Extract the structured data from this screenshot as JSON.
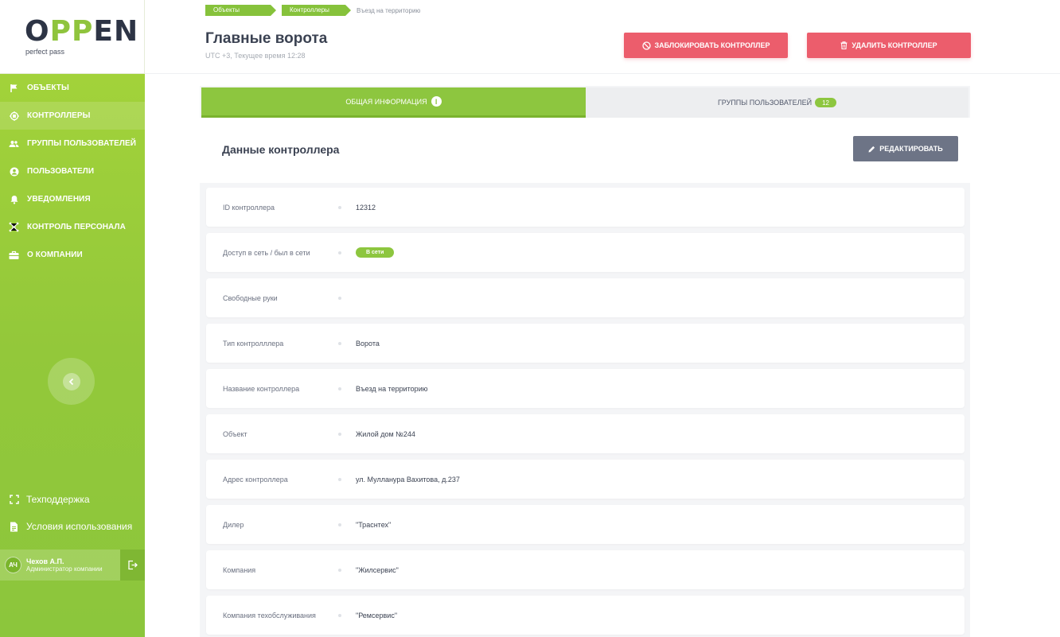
{
  "brand": {
    "logo_prefix": "O",
    "logo_accent": "PP",
    "logo_suffix": "EN",
    "tagline": "perfect pass",
    "accent_color": "#8dc63f"
  },
  "sidebar": {
    "items": [
      {
        "label": "ОБЪЕКТЫ",
        "icon": "flag-icon"
      },
      {
        "label": "КОНТРОЛЛЕРЫ",
        "icon": "chip-icon"
      },
      {
        "label": "ГРУППЫ ПОЛЬЗОВАТЕЛЕЙ",
        "icon": "users-icon"
      },
      {
        "label": "ПОЛЬЗОВАТЕЛИ",
        "icon": "user-icon"
      },
      {
        "label": "УВЕДОМЛЕНИЯ",
        "icon": "bell-icon"
      },
      {
        "label": "КОНТРОЛЬ ПЕРСОНАЛА",
        "icon": "network-icon"
      },
      {
        "label": "О КОМПАНИИ",
        "icon": "briefcase-icon"
      }
    ],
    "support": "Техподдержка",
    "terms": "Условия использования",
    "user": {
      "initials": "АЧ",
      "name": "Чехов А.П.",
      "role": "Администратор компании"
    }
  },
  "breadcrumbs": {
    "objects": "Объекты",
    "controllers": "Контроллеры",
    "current": "Въезд на территорию"
  },
  "header": {
    "title": "Главные ворота",
    "subtitle": "UTC +3, Текущее время 12:28",
    "block_label": "ЗАБЛОКИРОВАТЬ КОНТРОЛЛЕР",
    "delete_label": "УДАЛИТЬ КОНТРОЛЛЕР",
    "danger_color": "#ec5d6c"
  },
  "tabs": {
    "general": {
      "label": "ОБЩАЯ ИНФОРМАЦИЯ",
      "badge": "i"
    },
    "groups": {
      "label": "ГРУППЫ ПОЛЬЗОВАТЕЛЕЙ",
      "badge": "12"
    }
  },
  "card": {
    "title": "Данные контроллера",
    "edit_label": "РЕДАКТИРОВАТЬ"
  },
  "details": {
    "id": {
      "label": "ID контроллера",
      "value": "12312"
    },
    "online": {
      "label": "Доступ в сеть / был в сети",
      "value": "В сети"
    },
    "handsfree": {
      "label": "Свободные руки",
      "value": ""
    },
    "type": {
      "label": "Тип контролллера",
      "value": "Ворота"
    },
    "name": {
      "label": "Название контроллера",
      "value": "Въезд на территорию"
    },
    "object": {
      "label": "Объект",
      "value": "Жилой дом №244"
    },
    "address": {
      "label": "Адрес контроллера",
      "value": "ул. Мулланура Вахитова, д.237"
    },
    "dealer": {
      "label": "Дилер",
      "value": "\"Траснтех\""
    },
    "company": {
      "label": "Компания",
      "value": "\"Жилсервис\""
    },
    "service": {
      "label": "Компания техобслуживания",
      "value": "\"Ремсервис\""
    }
  }
}
